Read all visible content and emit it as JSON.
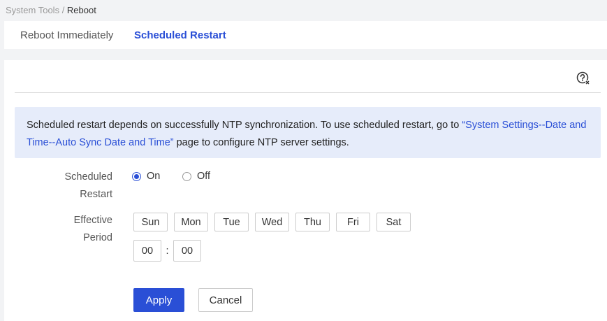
{
  "breadcrumb": {
    "parent": "System Tools",
    "separator": " / ",
    "current": "Reboot"
  },
  "tabs": [
    {
      "label": "Reboot Immediately",
      "active": false
    },
    {
      "label": "Scheduled Restart",
      "active": true
    }
  ],
  "help": {
    "icon": "help-icon"
  },
  "notice": {
    "text_before": "Scheduled restart depends on successfully NTP synchronization. To use scheduled restart, go to ",
    "link": "“System Settings--Date and Time--Auto Sync Date and Time”",
    "text_after": " page to configure NTP server settings."
  },
  "scheduled_restart": {
    "label_line1": "Scheduled",
    "label_line2": "Restart",
    "options": [
      {
        "label": "On",
        "checked": true
      },
      {
        "label": "Off",
        "checked": false
      }
    ]
  },
  "effective_period": {
    "label_line1": "Effective",
    "label_line2": "Period",
    "days": [
      "Sun",
      "Mon",
      "Tue",
      "Wed",
      "Thu",
      "Fri",
      "Sat"
    ],
    "hour": "00",
    "minute": "00",
    "separator": ":"
  },
  "actions": {
    "apply": "Apply",
    "cancel": "Cancel"
  },
  "colors": {
    "accent": "#2a4fd6",
    "notice_bg": "#e6ecfa",
    "background": "#f2f3f5"
  }
}
